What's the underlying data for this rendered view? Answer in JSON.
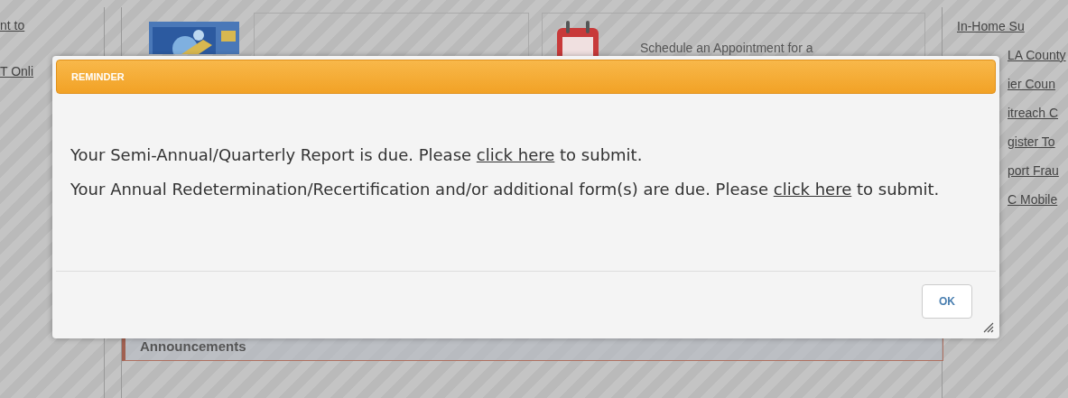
{
  "left_links": [
    "nt to",
    "T Onli"
  ],
  "cards": [
    {
      "kind": "picture"
    },
    {
      "kind": "calendar",
      "text": "Schedule an Appointment for a"
    }
  ],
  "right_links": [
    {
      "label": "In-Home Su",
      "covered": false
    },
    {
      "label": "LA County",
      "covered": true
    },
    {
      "label": "ier Coun",
      "covered": true
    },
    {
      "label": "itreach C",
      "covered": true
    },
    {
      "label": "gister To",
      "covered": true
    },
    {
      "label": "port Frau",
      "covered": true
    },
    {
      "label": "C Mobile",
      "covered": true
    }
  ],
  "announcements": {
    "title": "Announcements"
  },
  "dialog": {
    "title": "REMINDER",
    "messages": [
      {
        "before": "Your Semi-Annual/Quarterly Report is due. Please ",
        "link": "click here",
        "after": " to submit."
      },
      {
        "before": "Your Annual Redetermination/Recertification and/or additional form(s) are due. Please ",
        "link": "click here",
        "after": " to submit."
      }
    ],
    "button": "OK"
  }
}
